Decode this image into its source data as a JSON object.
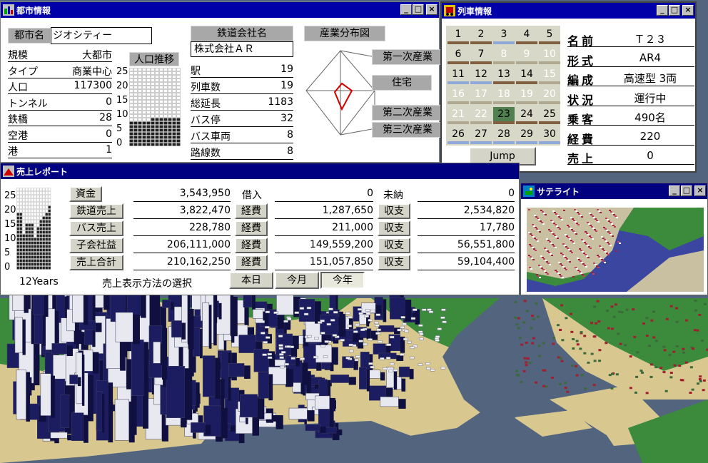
{
  "city_window": {
    "title": "都市情報",
    "city_name_label": "都市名",
    "city_name_value": "ジオシティー",
    "stats": [
      {
        "label": "規模",
        "value": "大都市"
      },
      {
        "label": "タイプ",
        "value": "商業中心"
      },
      {
        "label": "人口",
        "value": "117300"
      },
      {
        "label": "トンネル",
        "value": "0"
      },
      {
        "label": "鉄橋",
        "value": "28"
      },
      {
        "label": "空港",
        "value": "0"
      },
      {
        "label": "港",
        "value": "1"
      }
    ],
    "pop_chart_label": "人口推移",
    "pop_axis": [
      "25",
      "20",
      "15",
      "10",
      "5",
      "0"
    ],
    "company_label": "鉄道会社名",
    "company_value": "株式会社ＡＲ",
    "company_stats": [
      {
        "label": "駅",
        "value": "19"
      },
      {
        "label": "列車数",
        "value": "19"
      },
      {
        "label": "総延長",
        "value": "1183"
      },
      {
        "label": "バス停",
        "value": "32"
      },
      {
        "label": "バス車両",
        "value": "8"
      },
      {
        "label": "路線数",
        "value": "8"
      }
    ],
    "industry_button": "産業分布図",
    "industry_labels": [
      "第一次産業",
      "住宅",
      "第二次産業",
      "第三次産業"
    ]
  },
  "train_window": {
    "title": "列車情報",
    "cells": [
      "1",
      "2",
      "3",
      "4",
      "5",
      "6",
      "7",
      "8",
      "9",
      "10",
      "11",
      "12",
      "13",
      "14",
      "15",
      "16",
      "17",
      "18",
      "19",
      "20",
      "21",
      "22",
      "23",
      "24",
      "25",
      "26",
      "27",
      "28",
      "29",
      "30"
    ],
    "jump_label": "Jump",
    "fields": [
      {
        "label": "名前",
        "value": "Ｔ２３"
      },
      {
        "label": "形式",
        "value": "AR4"
      },
      {
        "label": "編成",
        "value": "高速型 3両"
      },
      {
        "label": "状況",
        "value": "運行中"
      },
      {
        "label": "乗客",
        "value": "490名"
      },
      {
        "label": "経費",
        "value": "220"
      },
      {
        "label": "売上",
        "value": "0"
      }
    ]
  },
  "sales_window": {
    "title": "売上レポート",
    "axis": [
      "25",
      "20",
      "15",
      "10",
      "5",
      "0"
    ],
    "years_label": "12Years",
    "selection_label": "売上表示方法の選択",
    "rows": [
      {
        "label": "資金",
        "value": "3,543,950",
        "mid_label": "借入",
        "mid_value": "0",
        "right_label": "未納",
        "right_value": "0"
      },
      {
        "label": "鉄道売上",
        "value": "3,822,470",
        "mid_label": "経費",
        "mid_value": "1,287,650",
        "right_label": "収支",
        "right_value": "2,534,820"
      },
      {
        "label": "バス売上",
        "value": "228,780",
        "mid_label": "経費",
        "mid_value": "211,000",
        "right_label": "収支",
        "right_value": "17,780"
      },
      {
        "label": "子会社益",
        "value": "206,111,000",
        "mid_label": "経費",
        "mid_value": "149,559,200",
        "right_label": "収支",
        "right_value": "56,551,800"
      },
      {
        "label": "売上合計",
        "value": "210,162,250",
        "mid_label": "経費",
        "mid_value": "151,057,850",
        "right_label": "収支",
        "right_value": "59,104,400"
      }
    ],
    "period_buttons": [
      "本日",
      "今月",
      "今年"
    ]
  },
  "satellite_window": {
    "title": "サテライト"
  },
  "colors": {
    "title_active": "#0000a8",
    "sea": "#52647e",
    "land": "#d8c890",
    "hill": "#3c8a3c"
  }
}
